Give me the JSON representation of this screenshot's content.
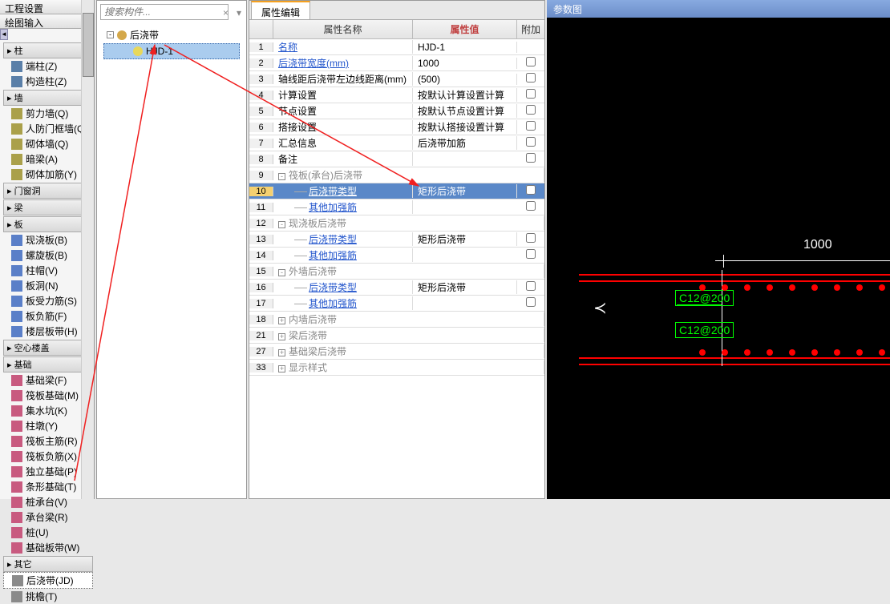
{
  "left": {
    "header1": "工程设置",
    "header2": "绘图输入",
    "groups": [
      {
        "type": "group",
        "label": "柱"
      },
      {
        "type": "item",
        "label": "端柱(Z)",
        "ico": "ico-col"
      },
      {
        "type": "item",
        "label": "构造柱(Z)",
        "ico": "ico-col"
      },
      {
        "type": "group",
        "label": "墙"
      },
      {
        "type": "item",
        "label": "剪力墙(Q)",
        "ico": "ico-wall"
      },
      {
        "type": "item",
        "label": "人防门框墙(Q)",
        "ico": "ico-wall"
      },
      {
        "type": "item",
        "label": "砌体墙(Q)",
        "ico": "ico-wall"
      },
      {
        "type": "item",
        "label": "暗梁(A)",
        "ico": "ico-wall"
      },
      {
        "type": "item",
        "label": "砌体加筋(Y)",
        "ico": "ico-wall"
      },
      {
        "type": "group",
        "label": "门窗洞"
      },
      {
        "type": "group",
        "label": "梁"
      },
      {
        "type": "group",
        "label": "板"
      },
      {
        "type": "item",
        "label": "现浇板(B)",
        "ico": "ico-slab"
      },
      {
        "type": "item",
        "label": "螺旋板(B)",
        "ico": "ico-slab"
      },
      {
        "type": "item",
        "label": "柱帽(V)",
        "ico": "ico-slab"
      },
      {
        "type": "item",
        "label": "板洞(N)",
        "ico": "ico-slab"
      },
      {
        "type": "item",
        "label": "板受力筋(S)",
        "ico": "ico-slab"
      },
      {
        "type": "item",
        "label": "板负筋(F)",
        "ico": "ico-slab"
      },
      {
        "type": "item",
        "label": "楼层板带(H)",
        "ico": "ico-slab"
      },
      {
        "type": "group",
        "label": "空心楼盖"
      },
      {
        "type": "group",
        "label": "基础"
      },
      {
        "type": "item",
        "label": "基础梁(F)",
        "ico": "ico-found"
      },
      {
        "type": "item",
        "label": "筏板基础(M)",
        "ico": "ico-found"
      },
      {
        "type": "item",
        "label": "集水坑(K)",
        "ico": "ico-found"
      },
      {
        "type": "item",
        "label": "柱墩(Y)",
        "ico": "ico-found"
      },
      {
        "type": "item",
        "label": "筏板主筋(R)",
        "ico": "ico-found"
      },
      {
        "type": "item",
        "label": "筏板负筋(X)",
        "ico": "ico-found"
      },
      {
        "type": "item",
        "label": "独立基础(P)",
        "ico": "ico-found"
      },
      {
        "type": "item",
        "label": "条形基础(T)",
        "ico": "ico-found"
      },
      {
        "type": "item",
        "label": "桩承台(V)",
        "ico": "ico-found"
      },
      {
        "type": "item",
        "label": "承台梁(R)",
        "ico": "ico-found"
      },
      {
        "type": "item",
        "label": "桩(U)",
        "ico": "ico-found"
      },
      {
        "type": "item",
        "label": "基础板带(W)",
        "ico": "ico-found"
      },
      {
        "type": "group",
        "label": "其它"
      },
      {
        "type": "item",
        "label": "后浇带(JD)",
        "ico": "ico-other",
        "selected": true
      },
      {
        "type": "item",
        "label": "挑檐(T)",
        "ico": "ico-other"
      }
    ]
  },
  "tree": {
    "search_placeholder": "搜索构件...",
    "root": "后浇带",
    "child": "HJD-1"
  },
  "prop": {
    "tab": "属性编辑",
    "hdr_name": "属性名称",
    "hdr_val": "属性值",
    "hdr_add": "附加",
    "rows": [
      {
        "n": "1",
        "name": "名称",
        "val": "HJD-1",
        "link": true,
        "chk": false
      },
      {
        "n": "2",
        "name": "后浇带宽度(mm)",
        "val": "1000",
        "link": true,
        "chk": true
      },
      {
        "n": "3",
        "name": "轴线距后浇带左边线距离(mm)",
        "val": "(500)",
        "link": false,
        "chk": true
      },
      {
        "n": "4",
        "name": "计算设置",
        "val": "按默认计算设置计算",
        "link": false,
        "chk": true
      },
      {
        "n": "5",
        "name": "节点设置",
        "val": "按默认节点设置计算",
        "link": false,
        "chk": true
      },
      {
        "n": "6",
        "name": "搭接设置",
        "val": "按默认搭接设置计算",
        "link": false,
        "chk": true
      },
      {
        "n": "7",
        "name": "汇总信息",
        "val": "后浇带加筋",
        "link": false,
        "chk": true
      },
      {
        "n": "8",
        "name": "备注",
        "val": "",
        "link": false,
        "chk": true
      },
      {
        "n": "9",
        "name": "筏板(承台)后浇带",
        "grp": true,
        "exp": "-"
      },
      {
        "n": "10",
        "name": "后浇带类型",
        "val": "矩形后浇带",
        "sub": true,
        "sel": true,
        "chk": true
      },
      {
        "n": "11",
        "name": "其他加强筋",
        "sub": true,
        "chk": true
      },
      {
        "n": "12",
        "name": "现浇板后浇带",
        "grp": true,
        "exp": "-"
      },
      {
        "n": "13",
        "name": "后浇带类型",
        "val": "矩形后浇带",
        "sub": true,
        "chk": true
      },
      {
        "n": "14",
        "name": "其他加强筋",
        "sub": true,
        "chk": true
      },
      {
        "n": "15",
        "name": "外墙后浇带",
        "grp": true,
        "exp": "-"
      },
      {
        "n": "16",
        "name": "后浇带类型",
        "val": "矩形后浇带",
        "sub": true,
        "chk": true
      },
      {
        "n": "17",
        "name": "其他加强筋",
        "sub": true,
        "chk": true
      },
      {
        "n": "18",
        "name": "内墙后浇带",
        "grp": true,
        "exp": "+"
      },
      {
        "n": "21",
        "name": "梁后浇带",
        "grp": true,
        "exp": "+"
      },
      {
        "n": "27",
        "name": "基础梁后浇带",
        "grp": true,
        "exp": "+"
      },
      {
        "n": "33",
        "name": "显示样式",
        "grp": true,
        "exp": "+"
      }
    ]
  },
  "draw": {
    "title": "参数图",
    "dim": "1000",
    "rebar1": "C12@200",
    "rebar2": "C12@200"
  }
}
